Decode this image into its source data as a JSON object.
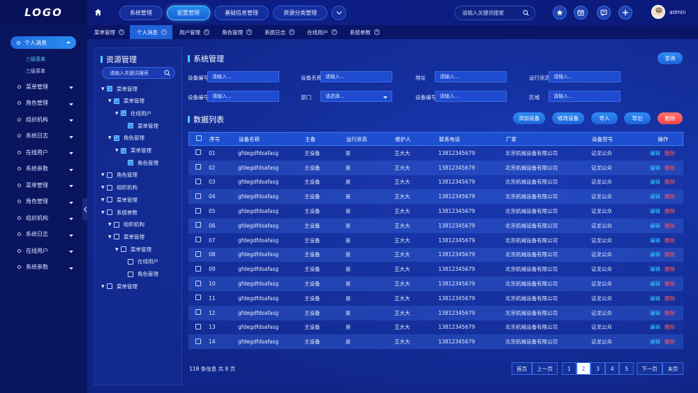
{
  "logo": "LOGO",
  "colors": {
    "accent": "#2a8cf0",
    "danger": "#ef4a4a",
    "highlight": "#3ed0ff"
  },
  "topnav": {
    "items": [
      "系统管理",
      "配置管理",
      "基础信息管理",
      "资源分类管理"
    ],
    "active_index": 1,
    "search_placeholder": "请输入关键词搜索",
    "user": "admin"
  },
  "sidebar": {
    "active": "个人消息",
    "sub_items": [
      "三级菜单",
      "三级菜单"
    ],
    "items": [
      "菜单管理",
      "角色管理",
      "组织机构",
      "系统日志",
      "在线用户",
      "系统参数",
      "菜单管理",
      "角色管理",
      "组织机构",
      "系统日志",
      "在线用户",
      "系统参数"
    ]
  },
  "tabs": [
    "菜单管理",
    "个人消息",
    "用户管理",
    "角色管理",
    "系统日志",
    "在线用户",
    "系统参数"
  ],
  "tabs_active_index": 1,
  "resource": {
    "title": "资源管理",
    "search_placeholder": "请输入关键词搜索",
    "tree": [
      {
        "label": "菜单管理",
        "level": 0,
        "arrow": true,
        "checked": true
      },
      {
        "label": "菜单管理",
        "level": 1,
        "arrow": true,
        "checked": true
      },
      {
        "label": "在线用户",
        "level": 2,
        "arrow": true,
        "checked": true
      },
      {
        "label": "菜单管理",
        "level": 3,
        "arrow": false,
        "checked": true
      },
      {
        "label": "角色管理",
        "level": 1,
        "arrow": true,
        "checked": true
      },
      {
        "label": "菜单管理",
        "level": 2,
        "arrow": true,
        "checked": true
      },
      {
        "label": "角色管理",
        "level": 3,
        "arrow": false,
        "checked": true
      },
      {
        "label": "角色管理",
        "level": 0,
        "arrow": true,
        "checked": false
      },
      {
        "label": "组织机构",
        "level": 0,
        "arrow": true,
        "checked": false
      },
      {
        "label": "菜单管理",
        "level": 0,
        "arrow": true,
        "checked": false
      },
      {
        "label": "系统参数",
        "level": 0,
        "arrow": true,
        "checked": false
      },
      {
        "label": "组织机构",
        "level": 1,
        "arrow": true,
        "checked": false
      },
      {
        "label": "菜单管理",
        "level": 1,
        "arrow": true,
        "checked": false
      },
      {
        "label": "菜单管理",
        "level": 2,
        "arrow": true,
        "checked": false
      },
      {
        "label": "在线用户",
        "level": 3,
        "arrow": false,
        "checked": false
      },
      {
        "label": "角色管理",
        "level": 3,
        "arrow": false,
        "checked": false
      },
      {
        "label": "菜单管理",
        "level": 0,
        "arrow": true,
        "checked": false
      }
    ]
  },
  "system": {
    "title": "系统管理",
    "query_button": "查询",
    "fields": [
      {
        "label": "设备编号",
        "placeholder": "请输入..."
      },
      {
        "label": "设备名称",
        "placeholder": "请输入..."
      },
      {
        "label": "地址",
        "placeholder": "请输入..."
      },
      {
        "label": "运行状态",
        "placeholder": "请输入..."
      },
      {
        "label": "设备编号",
        "placeholder": "请输入..."
      },
      {
        "label": "部门",
        "placeholder": "请选择...",
        "select": true
      },
      {
        "label": "设备编号",
        "placeholder": "请输入..."
      },
      {
        "label": "区域",
        "placeholder": "请输入..."
      }
    ]
  },
  "data_list": {
    "title": "数据列表",
    "buttons": [
      "添加设备",
      "修改设备",
      "导入",
      "导出",
      "删除"
    ],
    "columns": [
      "序号",
      "设备名称",
      "主备",
      "运行状态",
      "维护人",
      "联系电话",
      "厂家",
      "设备型号",
      "操作"
    ],
    "row_template": {
      "name": "gfdegdfdsafasg",
      "main": "主设备",
      "state": "是",
      "person": "王大大",
      "phone": "13812345679",
      "maker": "北京机械设备有限公司",
      "model": "证龙公众"
    },
    "row_numbers": [
      "01",
      "02",
      "03",
      "04",
      "05",
      "06",
      "07",
      "08",
      "09",
      "10",
      "11",
      "12",
      "13",
      "14"
    ],
    "op_edit": "编辑",
    "op_delete": "删除"
  },
  "footer": {
    "summary": "118 条信息 共 8 页",
    "first": "首页",
    "prev": "上一页",
    "pages": [
      "1",
      "2",
      "3",
      "4",
      "5"
    ],
    "current_page": "2",
    "next": "下一页",
    "last": "末页"
  }
}
